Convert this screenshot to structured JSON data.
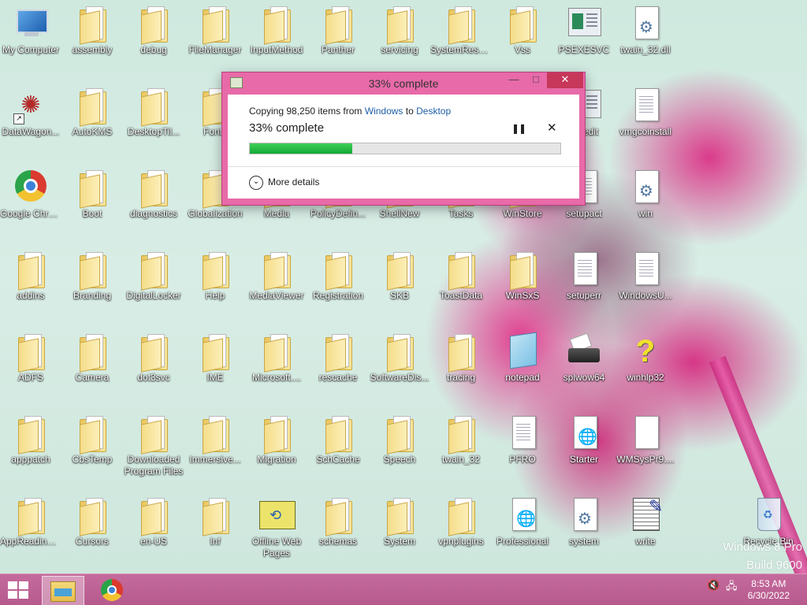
{
  "desktop": {
    "watermark_line1": "Windows 8 Pro",
    "watermark_line2": "Build 9600",
    "icons": [
      {
        "label": "My Computer",
        "kind": "computer"
      },
      {
        "label": "assembly",
        "kind": "folder"
      },
      {
        "label": "debug",
        "kind": "folder"
      },
      {
        "label": "FileManager",
        "kind": "folder"
      },
      {
        "label": "InputMethod",
        "kind": "folder"
      },
      {
        "label": "Panther",
        "kind": "folder"
      },
      {
        "label": "servicing",
        "kind": "folder"
      },
      {
        "label": "SystemReso...",
        "kind": "folder"
      },
      {
        "label": "Vss",
        "kind": "folder"
      },
      {
        "label": "PSEXESVC",
        "kind": "app"
      },
      {
        "label": "twain_32.dll",
        "kind": "settings-doc"
      },
      {
        "label": "DataWagon...",
        "kind": "shortcut"
      },
      {
        "label": "AutoKMS",
        "kind": "folder"
      },
      {
        "label": "DesktopTil...",
        "kind": "folder"
      },
      {
        "label": "Fonts",
        "kind": "folder"
      },
      {
        "label": "regedit",
        "kind": "app"
      },
      {
        "label": "vmgcoinstall",
        "kind": "doc"
      },
      {
        "label": "Google Chrome",
        "kind": "chrome"
      },
      {
        "label": "Boot",
        "kind": "folder"
      },
      {
        "label": "diagnostics",
        "kind": "folder"
      },
      {
        "label": "Globalization",
        "kind": "folder"
      },
      {
        "label": "Media",
        "kind": "folder"
      },
      {
        "label": "PolicyDefin...",
        "kind": "folder"
      },
      {
        "label": "ShellNew",
        "kind": "folder"
      },
      {
        "label": "Tasks",
        "kind": "folder"
      },
      {
        "label": "WinStore",
        "kind": "folder"
      },
      {
        "label": "setupact",
        "kind": "doc"
      },
      {
        "label": "win",
        "kind": "settings-doc"
      },
      {
        "label": "addins",
        "kind": "folder"
      },
      {
        "label": "Branding",
        "kind": "folder"
      },
      {
        "label": "DigitalLocker",
        "kind": "folder"
      },
      {
        "label": "Help",
        "kind": "folder"
      },
      {
        "label": "MediaViewer",
        "kind": "folder"
      },
      {
        "label": "Registration",
        "kind": "folder"
      },
      {
        "label": "SKB",
        "kind": "folder"
      },
      {
        "label": "ToastData",
        "kind": "folder"
      },
      {
        "label": "WinSxS",
        "kind": "folder"
      },
      {
        "label": "setuperr",
        "kind": "doc"
      },
      {
        "label": "WindowsU...",
        "kind": "doc"
      },
      {
        "label": "ADFS",
        "kind": "folder"
      },
      {
        "label": "Camera",
        "kind": "folder"
      },
      {
        "label": "dot3svc",
        "kind": "folder"
      },
      {
        "label": "IME",
        "kind": "folder"
      },
      {
        "label": "Microsoft....",
        "kind": "folder"
      },
      {
        "label": "rescache",
        "kind": "folder"
      },
      {
        "label": "SoftwareDis...",
        "kind": "folder"
      },
      {
        "label": "tracing",
        "kind": "folder"
      },
      {
        "label": "notepad",
        "kind": "notepad"
      },
      {
        "label": "splwow64",
        "kind": "printer"
      },
      {
        "label": "winhlp32",
        "kind": "help"
      },
      {
        "label": "apppatch",
        "kind": "folder"
      },
      {
        "label": "CbsTemp",
        "kind": "folder"
      },
      {
        "label": "Downloaded Program Files",
        "kind": "folder"
      },
      {
        "label": "Immersive...",
        "kind": "folder"
      },
      {
        "label": "Migration",
        "kind": "folder"
      },
      {
        "label": "SchCache",
        "kind": "folder"
      },
      {
        "label": "Speech",
        "kind": "folder"
      },
      {
        "label": "twain_32",
        "kind": "folder"
      },
      {
        "label": "PFRO",
        "kind": "doc"
      },
      {
        "label": "Starter",
        "kind": "web-doc"
      },
      {
        "label": "WMSysPr9....",
        "kind": "blank-doc"
      },
      {
        "label": "AppReadiness",
        "kind": "folder"
      },
      {
        "label": "Cursors",
        "kind": "folder"
      },
      {
        "label": "en-US",
        "kind": "folder"
      },
      {
        "label": "Inf",
        "kind": "folder"
      },
      {
        "label": "Offline Web Pages",
        "kind": "offline"
      },
      {
        "label": "schemas",
        "kind": "folder"
      },
      {
        "label": "System",
        "kind": "folder"
      },
      {
        "label": "vpnplugins",
        "kind": "folder"
      },
      {
        "label": "Professional",
        "kind": "web-doc"
      },
      {
        "label": "system",
        "kind": "settings-doc"
      },
      {
        "label": "write",
        "kind": "write"
      },
      {
        "label": "Recycle Bin",
        "kind": "recycle"
      }
    ]
  },
  "dialog": {
    "title": "33% complete",
    "copy_prefix": "Copying 98,250 items from ",
    "source": "Windows",
    "to_word": " to ",
    "destination": "Desktop",
    "progress_text": "33% complete",
    "progress_value": 0.33,
    "more_details": "More details",
    "pause_glyph": "❚❚",
    "cancel_glyph": "✕",
    "min_glyph": "—",
    "max_glyph": "□",
    "close_glyph": "✕"
  },
  "taskbar": {
    "time": "8:53 AM",
    "date": "6/30/2022",
    "accent": "#b65a8d"
  }
}
